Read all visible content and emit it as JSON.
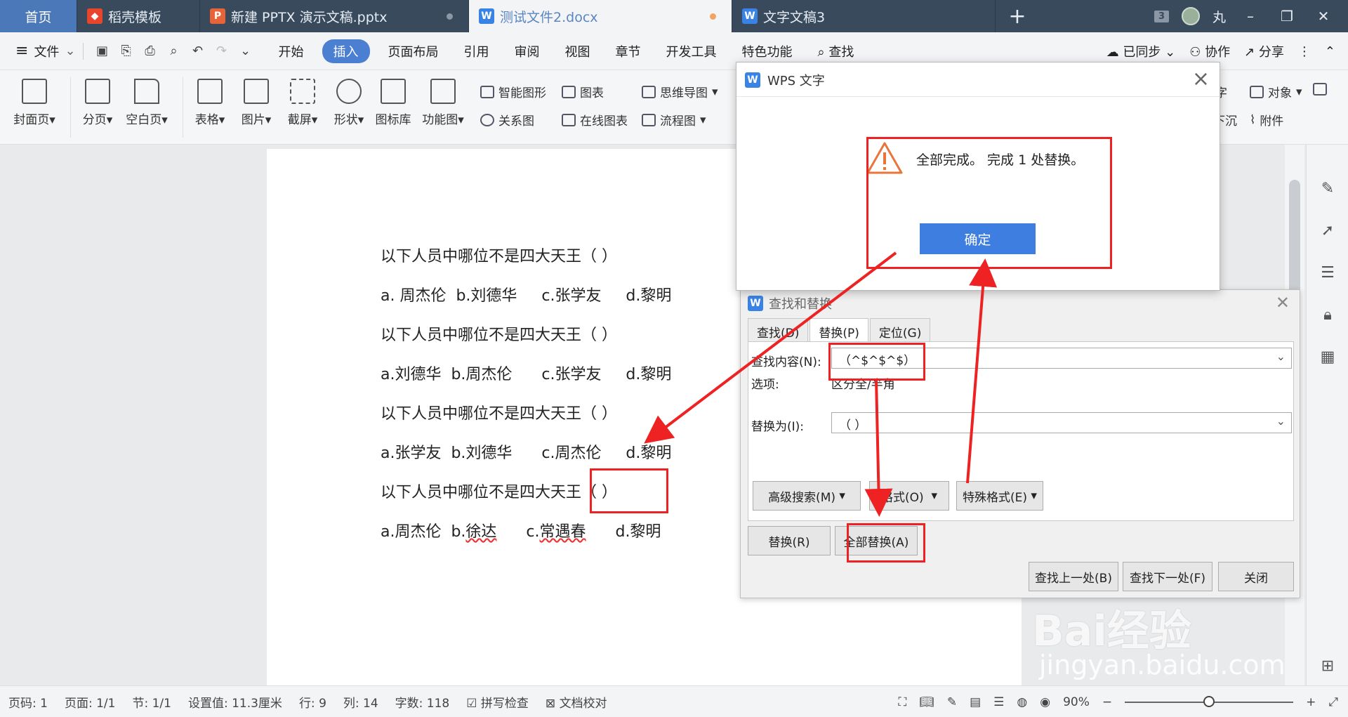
{
  "tabs": [
    {
      "label": "首页"
    },
    {
      "label": "稻壳模板"
    },
    {
      "label": "新建 PPTX 演示文稿.pptx"
    },
    {
      "label": "测试文件2.docx"
    },
    {
      "label": "文字文稿3"
    }
  ],
  "tabbar": {
    "window_count": "3",
    "user": "丸"
  },
  "menu": {
    "file": "文件",
    "items": [
      "开始",
      "插入",
      "页面布局",
      "引用",
      "审阅",
      "视图",
      "章节",
      "开发工具",
      "特色功能"
    ],
    "active": "插入",
    "search": "查找",
    "sync": "已同步",
    "collab": "协作",
    "share": "分享"
  },
  "ribbon": {
    "cover": "封面页",
    "pagebreak": "分页",
    "blank": "空白页",
    "table": "表格",
    "picture": "图片",
    "screenshot": "截屏",
    "shape": "形状",
    "iconlib": "图标库",
    "funcchart": "功能图",
    "smartart": "智能图形",
    "chart": "图表",
    "mindmap": "思维导图",
    "relation": "关系图",
    "onlinechart": "在线图表",
    "flowchart": "流程图",
    "numbers": "数字",
    "object": "对象",
    "sink": "下沉",
    "attachment": "附件"
  },
  "document": {
    "lines": [
      "以下人员中哪位不是四大天王（ ）",
      "a. 周杰伦  b.刘德华     c.张学友     d.黎明",
      "以下人员中哪位不是四大天王（ ）",
      "a.刘德华  b.周杰伦      c.张学友     d.黎明",
      "以下人员中哪位不是四大天王（ ）",
      "a.张学友  b.刘德华      c.周杰伦     d.黎明",
      "以下人员中哪位不是四大天王（ ）"
    ],
    "last_line": {
      "a": "a.周杰伦  b.",
      "xu": "徐达",
      "c": "      c.",
      "chang": "常遇春",
      "d": "      d.黎明"
    }
  },
  "status": {
    "page": "页码: 1",
    "pages": "页面: 1/1",
    "section": "节: 1/1",
    "setting": "设置值: 11.3厘米",
    "row": "行: 9",
    "col": "列: 14",
    "words": "字数: 118",
    "spell": "拼写检查",
    "proof": "文档校对",
    "zoom": "90%",
    "zoom_level": 0.5
  },
  "find_replace": {
    "title": "查找和替换",
    "tabs": [
      "查找(D)",
      "替换(P)",
      "定位(G)"
    ],
    "find_label": "查找内容(N):",
    "find_value": "（^$^$^$）",
    "options_label": "选项:",
    "options_value": "区分全/半角",
    "replace_label": "替换为(I):",
    "replace_value": "（ ）",
    "adv": "高级搜索(M)",
    "format": "格式(O)",
    "special": "特殊格式(E)",
    "replace_btn": "替换(R)",
    "replace_all": "全部替换(A)",
    "prev": "查找上一处(B)",
    "next": "查找下一处(F)",
    "close": "关闭"
  },
  "alert": {
    "title": "WPS 文字",
    "message": "全部完成。 完成 1 处替换。",
    "ok": "确定"
  },
  "watermark": {
    "brand": "Bai经验",
    "url": "jingyan.baidu.com"
  },
  "colors": {
    "accent": "#4a7fd1",
    "annotation": "#e22222",
    "tabbar": "#394a5d"
  }
}
